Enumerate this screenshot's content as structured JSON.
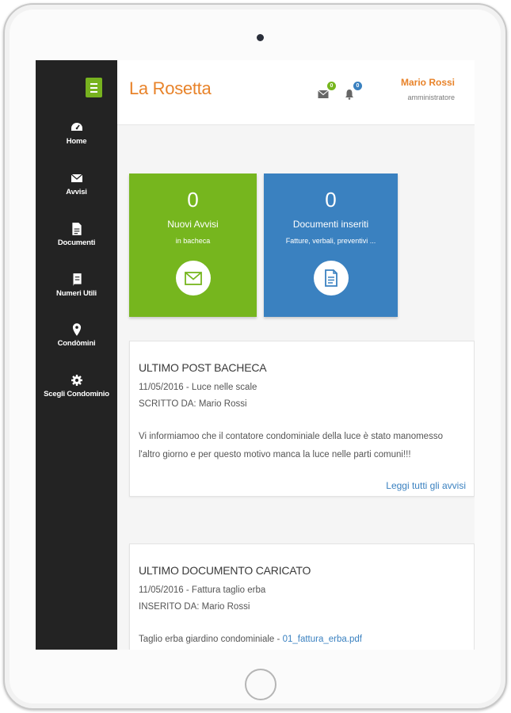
{
  "app": {
    "title": "La Rosetta"
  },
  "sidebar": {
    "items": [
      {
        "label": "Home",
        "icon": "dashboard-icon"
      },
      {
        "label": "Avvisi",
        "icon": "envelope-icon"
      },
      {
        "label": "Documenti",
        "icon": "document-icon"
      },
      {
        "label": "Numeri Utili",
        "icon": "phone-book-icon"
      },
      {
        "label": "Condòmini",
        "icon": "map-pin-icon"
      },
      {
        "label": "Scegli Condominio",
        "icon": "gear-icon"
      }
    ]
  },
  "header": {
    "messages_badge": "0",
    "notifications_badge": "0",
    "user_name": "Mario Rossi",
    "user_role": "amministratore"
  },
  "cards": {
    "avvisi": {
      "count": "0",
      "title": "Nuovi Avvisi",
      "subtitle": "in bacheca",
      "icon": "envelope-icon"
    },
    "documenti": {
      "count": "0",
      "title": "Documenti inseriti",
      "subtitle": "Fatture, verbali, preventivi ...",
      "icon": "document-icon"
    }
  },
  "post": {
    "heading": "ULTIMO POST BACHECA",
    "meta": "11/05/2016 - Luce nelle scale",
    "author": "SCRITTO DA: Mario Rossi",
    "body_line1": "Vi informiamoo che il contatore condominiale della luce è stato manomesso",
    "body_line2": "l'altro giorno e per questo motivo manca la luce nelle parti comuni!!!",
    "read_all": "Leggi tutti gli avvisi"
  },
  "document": {
    "heading": "ULTIMO DOCUMENTO CARICATO",
    "meta": "11/05/2016 - Fattura taglio erba",
    "author": "INSERITO DA: Mario Rossi",
    "description": "Taglio erba giardino condominiale - ",
    "file_link": "01_fattura_erba.pdf"
  },
  "colors": {
    "accent_orange": "#e8832a",
    "green": "#76b61e",
    "blue": "#3a81c0",
    "sidebar": "#232323"
  }
}
